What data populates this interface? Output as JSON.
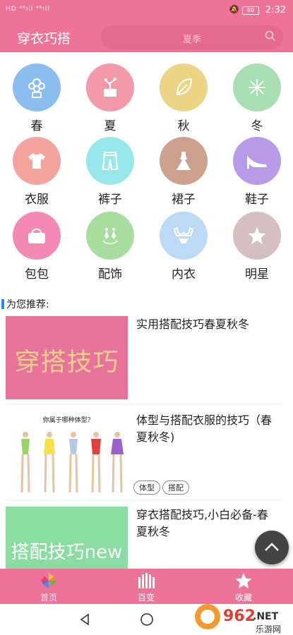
{
  "status": {
    "signal_left": "HD ⁴⁶ıll ⁴⁶ıll",
    "time": "2:32",
    "battery": "80"
  },
  "appbar": {
    "title": "穿衣巧搭",
    "search_placeholder": "夏季"
  },
  "categories": [
    {
      "label": "春",
      "icon": "flower-icon",
      "color": "#8cbdf0"
    },
    {
      "label": "夏",
      "icon": "potted-plant-icon",
      "color": "#f39aaa"
    },
    {
      "label": "秋",
      "icon": "leaf-icon",
      "color": "#ebd483"
    },
    {
      "label": "冬",
      "icon": "snowflake-icon",
      "color": "#a8deb1"
    },
    {
      "label": "衣服",
      "icon": "tshirt-icon",
      "color": "#f4a39f"
    },
    {
      "label": "裤子",
      "icon": "shorts-icon",
      "color": "#98e7ea"
    },
    {
      "label": "裙子",
      "icon": "dress-icon",
      "color": "#cca28f"
    },
    {
      "label": "鞋子",
      "icon": "high-heel-icon",
      "color": "#b79ae8"
    },
    {
      "label": "包包",
      "icon": "handbag-icon",
      "color": "#f48ab4"
    },
    {
      "label": "配饰",
      "icon": "earrings-icon",
      "color": "#a9dd9f"
    },
    {
      "label": "内衣",
      "icon": "lingerie-icon",
      "color": "#bcd9f6"
    },
    {
      "label": "明星",
      "icon": "star-icon",
      "color": "#d4c0c1"
    }
  ],
  "recommend": {
    "heading": "为您推荐:",
    "articles": [
      {
        "title": "实用搭配技巧春夏秋冬",
        "thumb_text": "穿搭技巧",
        "thumb_bg": "#e8739a",
        "thumb_fg": "#ecd08a",
        "tags": []
      },
      {
        "title": "体型与搭配衣服的技巧（春夏秋冬)",
        "thumb_text": "你属于哪种体型?",
        "thumb_bg": "#ffffff",
        "thumb_fg": "#222222",
        "tags": [
          "体型",
          "搭配"
        ]
      },
      {
        "title": "穿衣搭配技巧,小白必备-春夏秋冬",
        "thumb_text": "搭配技巧new",
        "thumb_bg": "#8bdca3",
        "thumb_fg": "#ffffff",
        "tags": []
      }
    ]
  },
  "tabs": [
    {
      "label": "首页",
      "icon": "pinwheel-icon"
    },
    {
      "label": "百变",
      "icon": "fan-icon"
    },
    {
      "label": "收藏",
      "icon": "star-icon"
    }
  ],
  "watermark": {
    "brand": "962",
    "suffix": ".NET",
    "subtitle": "乐游网"
  },
  "colors": {
    "brand": "#ed7398",
    "accent_blue": "#2e86ff"
  }
}
